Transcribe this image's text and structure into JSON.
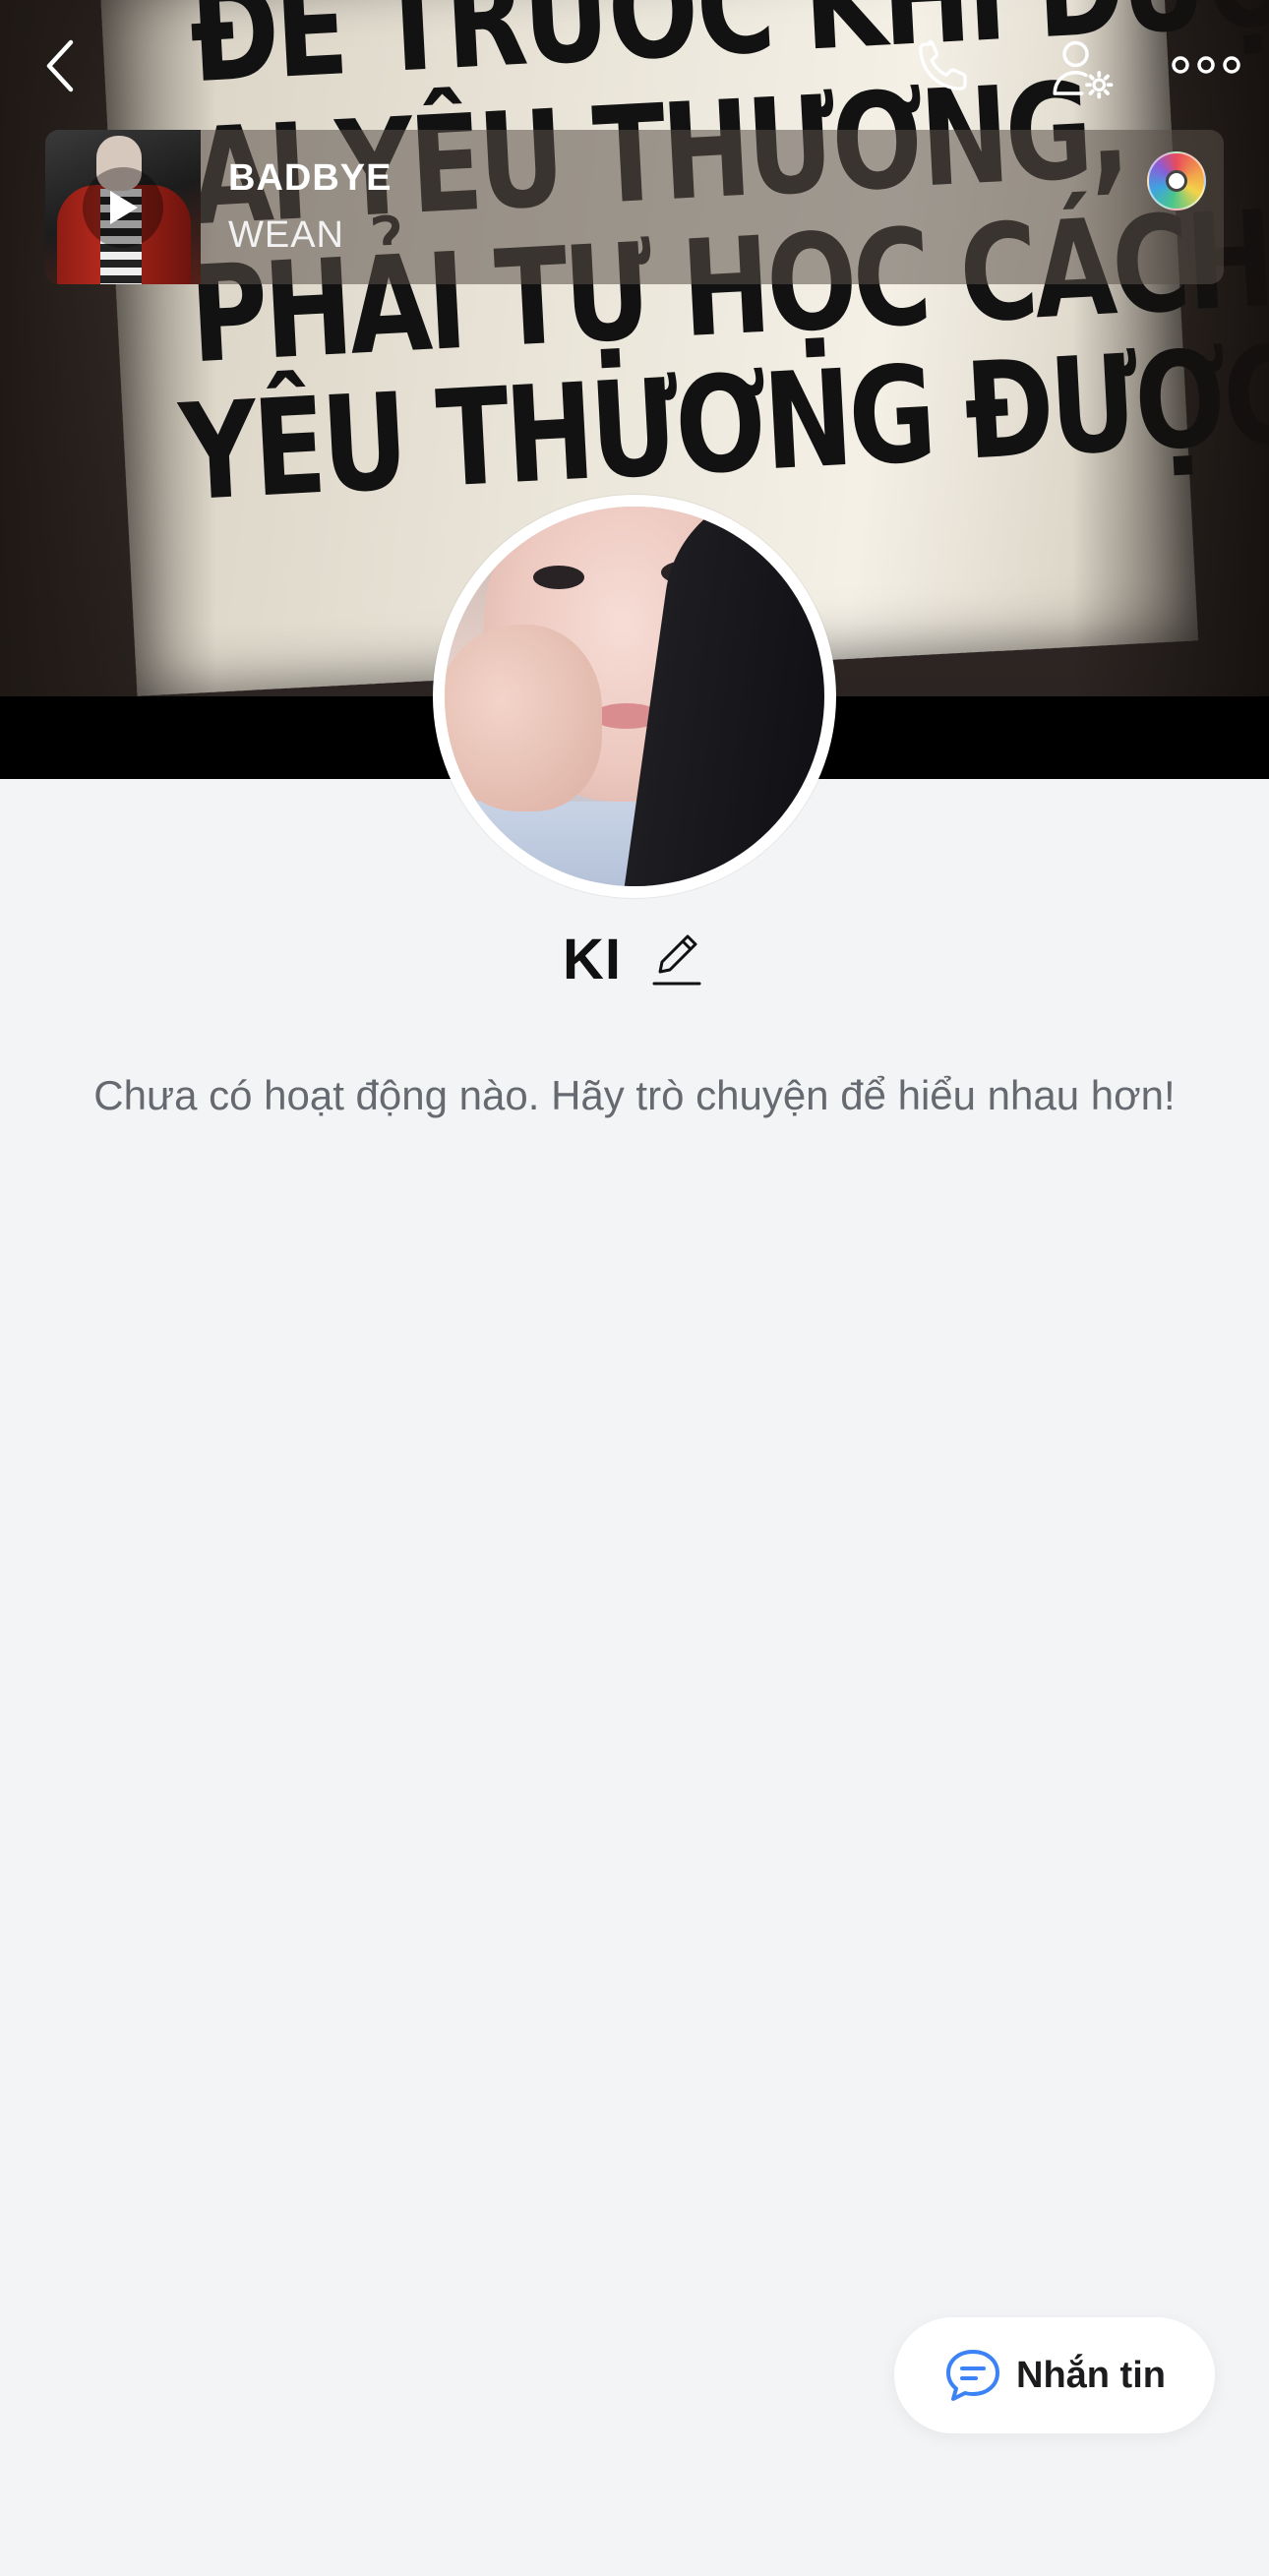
{
  "header": {
    "back_icon": "chevron-left-icon",
    "call_icon": "phone-icon",
    "settings_icon": "user-settings-icon",
    "more_icon": "more-horizontal-icon"
  },
  "cover": {
    "sign_lines": [
      "ĐỂ TRƯỚC KHI ĐƯỢC",
      "AI YÊU THƯƠNG,",
      "PHẢI TỰ HỌC CÁCH",
      "YÊU THƯƠNG ĐƯỢC MÌNH"
    ]
  },
  "music": {
    "title": "BADBYE",
    "artist": "WEAN"
  },
  "profile": {
    "name": "KI"
  },
  "empty_state": "Chưa có hoạt động nào. Hãy trò chuyện để hiểu nhau hơn!",
  "message_button": {
    "label": "Nhắn tin",
    "icon": "chat-bubble-icon",
    "icon_color": "#3b82f6"
  }
}
